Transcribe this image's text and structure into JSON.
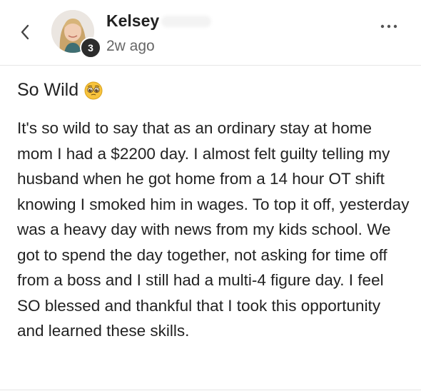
{
  "header": {
    "back_icon": "chevron-left-icon",
    "author_name": "Kelsey",
    "level": "3",
    "time_ago": "2w ago",
    "more_icon": "more-horizontal-icon"
  },
  "post": {
    "title": "So Wild",
    "title_emoji": "pleading-face-emoji",
    "body": "It's so wild to say that as an ordinary stay at home mom I had a $2200 day. I almost felt guilty telling my husband when he got home from a 14 hour OT shift knowing I smoked him in wages. To top it off, yesterday was a heavy day with news from my kids school. We got to spend the day together, not asking for time off from a boss and I still had a multi-4 figure day. I feel SO blessed and thankful that I took this opportunity and learned these skills."
  },
  "colors": {
    "text": "#222222",
    "muted": "#666666",
    "badge": "#2c2c2c",
    "divider": "#e6e6e6"
  }
}
